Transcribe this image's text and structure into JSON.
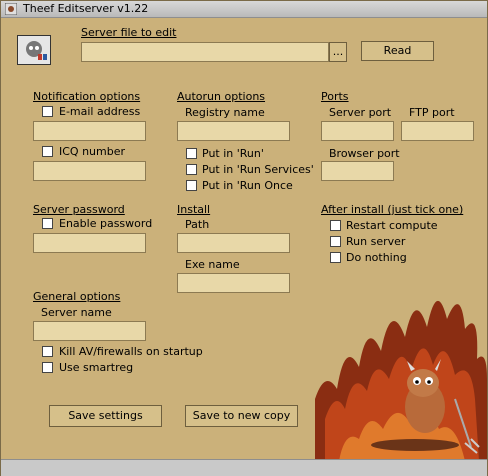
{
  "window": {
    "title": "Theef Editserver v1.22"
  },
  "server_file": {
    "label": "Server file to edit",
    "value": "",
    "browse_label": "...",
    "read_label": "Read"
  },
  "notification": {
    "title": "Notification options",
    "email_label": "E-mail address",
    "icq_label": "ICQ number"
  },
  "autorun": {
    "title": "Autorun options",
    "registry_label": "Registry name",
    "run_label": "Put in 'Run'",
    "run_services_label": "Put in 'Run Services'",
    "run_once_label": "Put in 'Run Once"
  },
  "ports": {
    "title": "Ports",
    "server_port_label": "Server port",
    "ftp_port_label": "FTP port",
    "browser_port_label": "Browser port"
  },
  "server_password": {
    "title": "Server password",
    "enable_label": "Enable password"
  },
  "install": {
    "title": "Install",
    "path_label": "Path",
    "exe_label": "Exe name"
  },
  "after_install": {
    "title": "After install (just tick one)",
    "restart_label": "Restart compute",
    "run_server_label": "Run server",
    "do_nothing_label": "Do nothing"
  },
  "general": {
    "title": "General options",
    "server_name_label": "Server name",
    "kill_label": "Kill AV/firewalls on startup",
    "smartreg_label": "Use smartreg"
  },
  "buttons": {
    "save_settings": "Save settings",
    "save_new_copy": "Save to new copy"
  },
  "colors": {
    "background": "#cbb17a",
    "field": "#e8d8a8",
    "fire": "#c0451a"
  }
}
